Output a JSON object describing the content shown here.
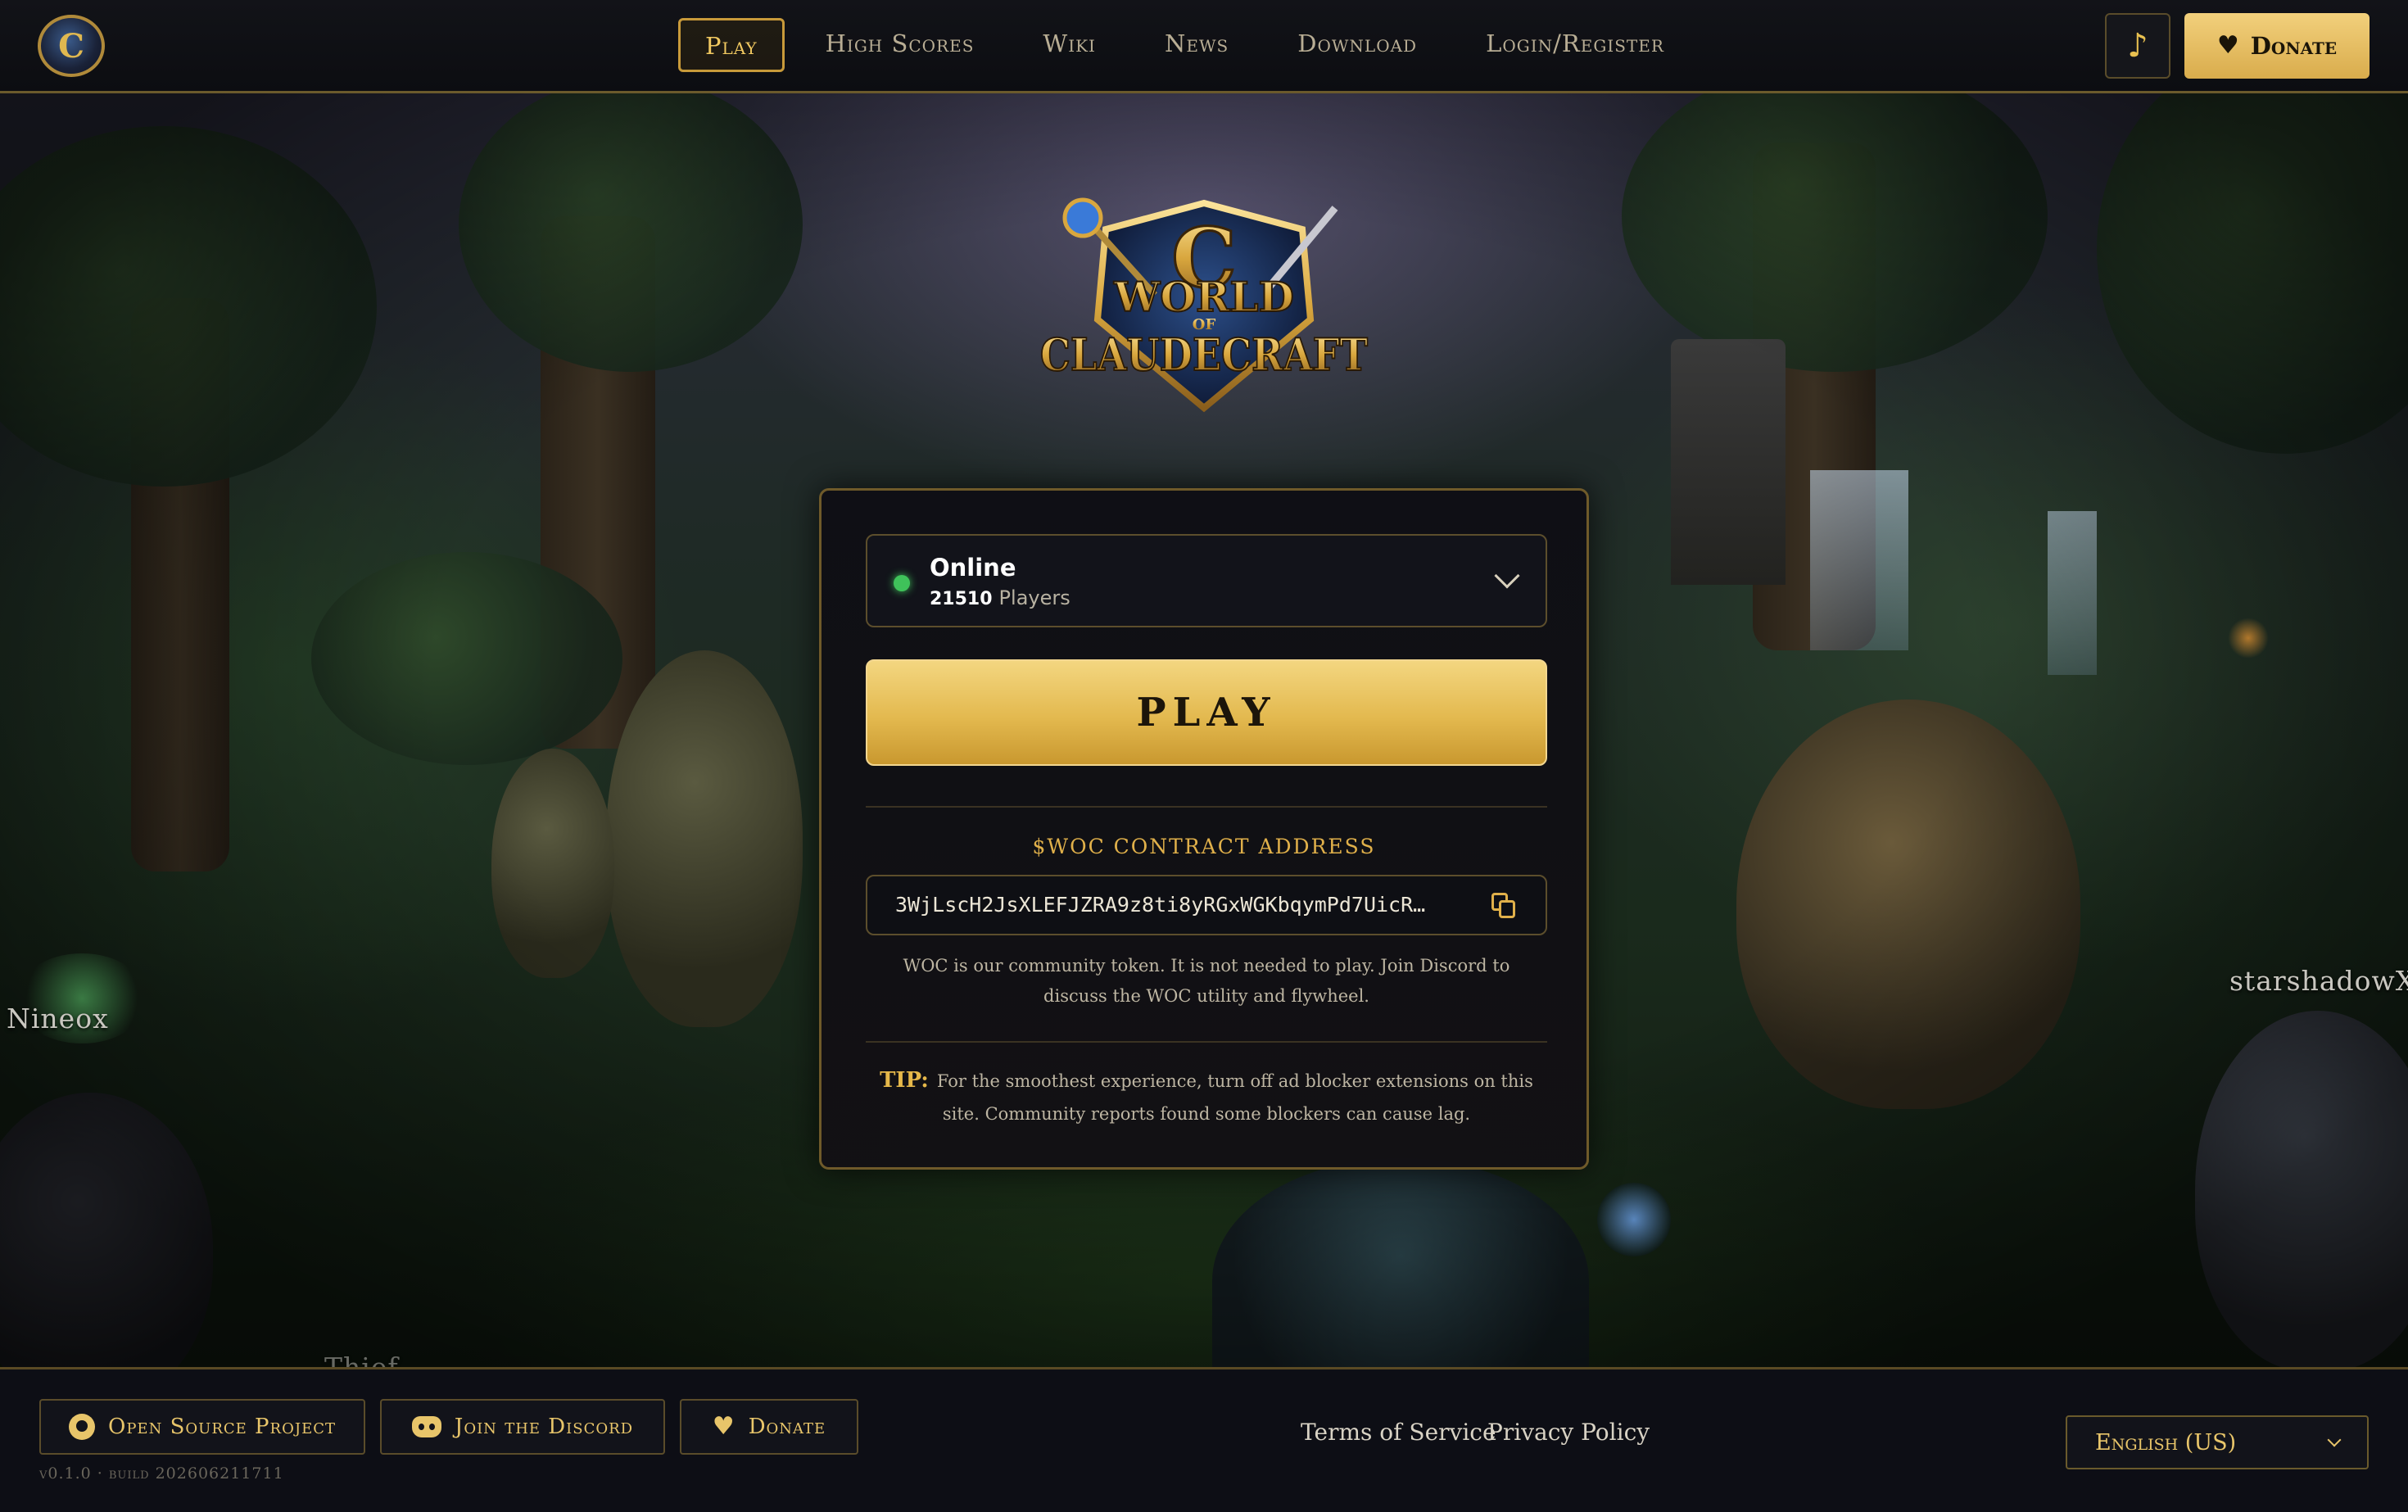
{
  "nav": {
    "items": [
      {
        "label": "Play",
        "active": true
      },
      {
        "label": "High Scores",
        "active": false
      },
      {
        "label": "Wiki",
        "active": false
      },
      {
        "label": "News",
        "active": false
      },
      {
        "label": "Download",
        "active": false
      },
      {
        "label": "Login/Register",
        "active": false
      }
    ],
    "music_icon": "music-note-icon",
    "donate_label": "Donate"
  },
  "logo": {
    "line1": "WORLD",
    "line2": "OF",
    "line3": "CLAUDECRAFT",
    "emblem_letter": "C"
  },
  "scene": {
    "player_names": [
      "Nineox",
      "starshadowX",
      "Thief"
    ]
  },
  "server": {
    "status": "Online",
    "status_color": "#3fc25a",
    "player_count": "21510",
    "players_label": "Players"
  },
  "play_button": "PLAY",
  "contract": {
    "title": "$WOC CONTRACT ADDRESS",
    "address": "3WjLscH2JsXLEFJZRA9z8ti8yRGxWGKbqymPd7UicR…",
    "note": "WOC is our community token. It is not needed to play. Join Discord to discuss the WOC utility and flywheel."
  },
  "tip": {
    "label": "TIP:",
    "text": "For the smoothest experience, turn off ad blocker extensions on this site. Community reports found some blockers can cause lag."
  },
  "footer": {
    "open_source": "Open Source Project",
    "discord": "Join the Discord",
    "donate": "Donate",
    "version": "v0.1.0 · build 202606211711",
    "terms": "Terms of Service",
    "privacy": "Privacy Policy",
    "language": "English (US)"
  },
  "colors": {
    "accent_gold": "#e0b04a",
    "play_button": "#e3b94f",
    "background": "#0b0d14"
  }
}
